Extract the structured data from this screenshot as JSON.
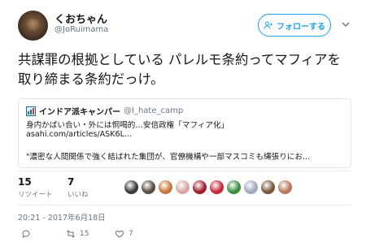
{
  "author": {
    "display_name": "くおちゃん",
    "screen_name": "@JoRuimama"
  },
  "follow_button": {
    "label": "フォローする",
    "icon": "add-user-icon"
  },
  "tweet": {
    "text": "共謀罪の根拠としている パレルモ条約ってマフィアを取り締まる条約だっけ。"
  },
  "quote": {
    "icon": "chart-icon",
    "name": "インドア派キャンパー",
    "handle": "@I_hate_camp",
    "line1": "身内かばい合い・外には恫喝的…安倍政権「マフィア化」",
    "line2": "asahi.com/articles/ASK6L...",
    "line3": "\"濃密な人間関係で強く結ばれた集団が、官僚機構や一部マスコミも縄張りにお..."
  },
  "stats": {
    "retweets": {
      "count": "15",
      "label": "リツイート"
    },
    "likes": {
      "count": "7",
      "label": "いいね"
    }
  },
  "likers": [
    {
      "name": "liker-1",
      "color": "#3a3a3a"
    },
    {
      "name": "liker-2",
      "color": "#5a4a40"
    },
    {
      "name": "liker-3",
      "color": "#c8783c"
    },
    {
      "name": "liker-4",
      "color": "#d8a8a0"
    },
    {
      "name": "liker-5",
      "color": "#a01e2a"
    },
    {
      "name": "liker-6",
      "color": "#c8283c"
    },
    {
      "name": "liker-7",
      "color": "#3c8c3c"
    },
    {
      "name": "liker-8",
      "color": "#a0a8c0"
    },
    {
      "name": "liker-9",
      "color": "#78583c"
    },
    {
      "name": "liker-10",
      "color": "#b8785a"
    }
  ],
  "timestamp": "20:21 - 2017年6月18日",
  "actions": {
    "reply": {
      "icon": "reply-icon",
      "count": ""
    },
    "retweet": {
      "icon": "retweet-icon",
      "count": "15"
    },
    "like": {
      "icon": "heart-icon",
      "count": "7"
    }
  },
  "colors": {
    "accent": "#1da1f2",
    "secondary_text": "#657786",
    "border": "#e1e8ed"
  }
}
